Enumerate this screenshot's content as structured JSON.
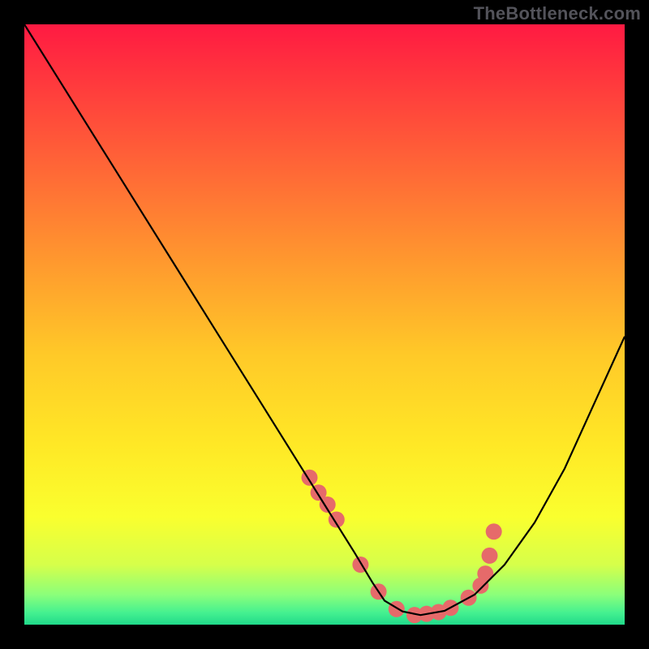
{
  "watermark": "TheBottleneck.com",
  "chart_data": {
    "type": "line",
    "title": "",
    "xlabel": "",
    "ylabel": "",
    "xlim": [
      0,
      100
    ],
    "ylim": [
      0,
      100
    ],
    "gradient_stops": [
      {
        "offset": 0.0,
        "color": "#ff1a42"
      },
      {
        "offset": 0.1,
        "color": "#ff3a3d"
      },
      {
        "offset": 0.25,
        "color": "#ff6a36"
      },
      {
        "offset": 0.4,
        "color": "#ff9a2e"
      },
      {
        "offset": 0.55,
        "color": "#ffc928"
      },
      {
        "offset": 0.7,
        "color": "#ffe826"
      },
      {
        "offset": 0.82,
        "color": "#faff2e"
      },
      {
        "offset": 0.9,
        "color": "#d6ff4a"
      },
      {
        "offset": 0.95,
        "color": "#8bff7a"
      },
      {
        "offset": 0.98,
        "color": "#45f190"
      },
      {
        "offset": 1.0,
        "color": "#20d98a"
      }
    ],
    "series": [
      {
        "name": "curve",
        "color": "#000000",
        "x": [
          0,
          5,
          10,
          15,
          20,
          25,
          30,
          35,
          40,
          45,
          50,
          55,
          58,
          60,
          63,
          66,
          70,
          75,
          80,
          85,
          90,
          95,
          100
        ],
        "y": [
          100,
          92,
          84,
          76,
          68,
          60,
          52,
          44,
          36,
          28,
          20,
          12,
          7,
          4,
          2.2,
          1.6,
          2.3,
          5,
          10,
          17,
          26,
          37,
          48
        ]
      }
    ],
    "markers": {
      "name": "points",
      "color": "#e66a6a",
      "radius": 10,
      "x": [
        47.5,
        49,
        50.5,
        52,
        56,
        59,
        62,
        65,
        67,
        69,
        71,
        74,
        76,
        76.8,
        77.5,
        78.2
      ],
      "y": [
        24.5,
        22,
        20,
        17.5,
        10,
        5.5,
        2.6,
        1.6,
        1.8,
        2.1,
        2.8,
        4.5,
        6.5,
        8.5,
        11.5,
        15.5
      ]
    }
  }
}
